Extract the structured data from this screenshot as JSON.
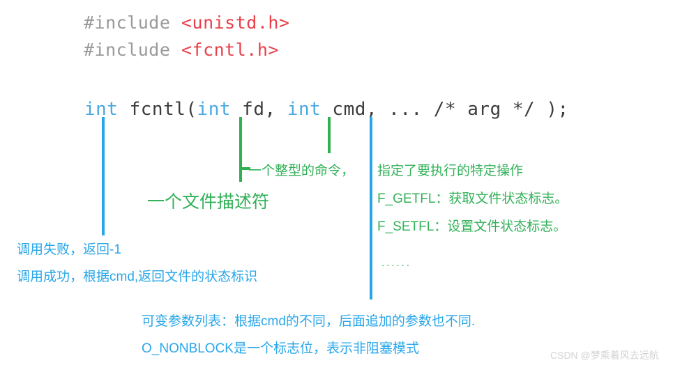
{
  "code": {
    "includes": [
      {
        "directive": "#include ",
        "header": "<unistd.h>"
      },
      {
        "directive": "#include ",
        "header": "<fcntl.h>"
      }
    ],
    "signature": {
      "ret_type": "int",
      "before_fd": " fcntl(",
      "fd_type": "int",
      "fd_name": " fd, ",
      "cmd_type": "int",
      "tail": " cmd, ... /* arg */ );"
    }
  },
  "annotations": {
    "fd_desc": "一个文件描述符",
    "cmd_desc": "一个整型的命令，",
    "cmd_op": "指定了要执行的特定操作",
    "getfl": "F_GETFL：获取文件状态标志。",
    "setfl": "F_SETFL：设置文件状态标志。",
    "ellipsis": "......",
    "ret_fail": "调用失败，返回-1",
    "ret_ok": "调用成功，根据cmd,返回文件的状态标识",
    "vararg_1": "可变参数列表：根据cmd的不同，后面追加的参数也不同.",
    "vararg_2": "O_NONBLOCK是一个标志位，表示非阻塞模式"
  },
  "watermark": {
    "text": "CSDN @梦乘着风去远航"
  },
  "colors": {
    "blue": "#29a6e8",
    "green": "#32b158",
    "code_keyword": "#4aa9e2",
    "code_text": "#3c3c3c",
    "include_gray": "#9a9a9a",
    "header_red": "#e8404a",
    "watermark_gray": "#d2d2d2",
    "background": "#ffffff"
  }
}
